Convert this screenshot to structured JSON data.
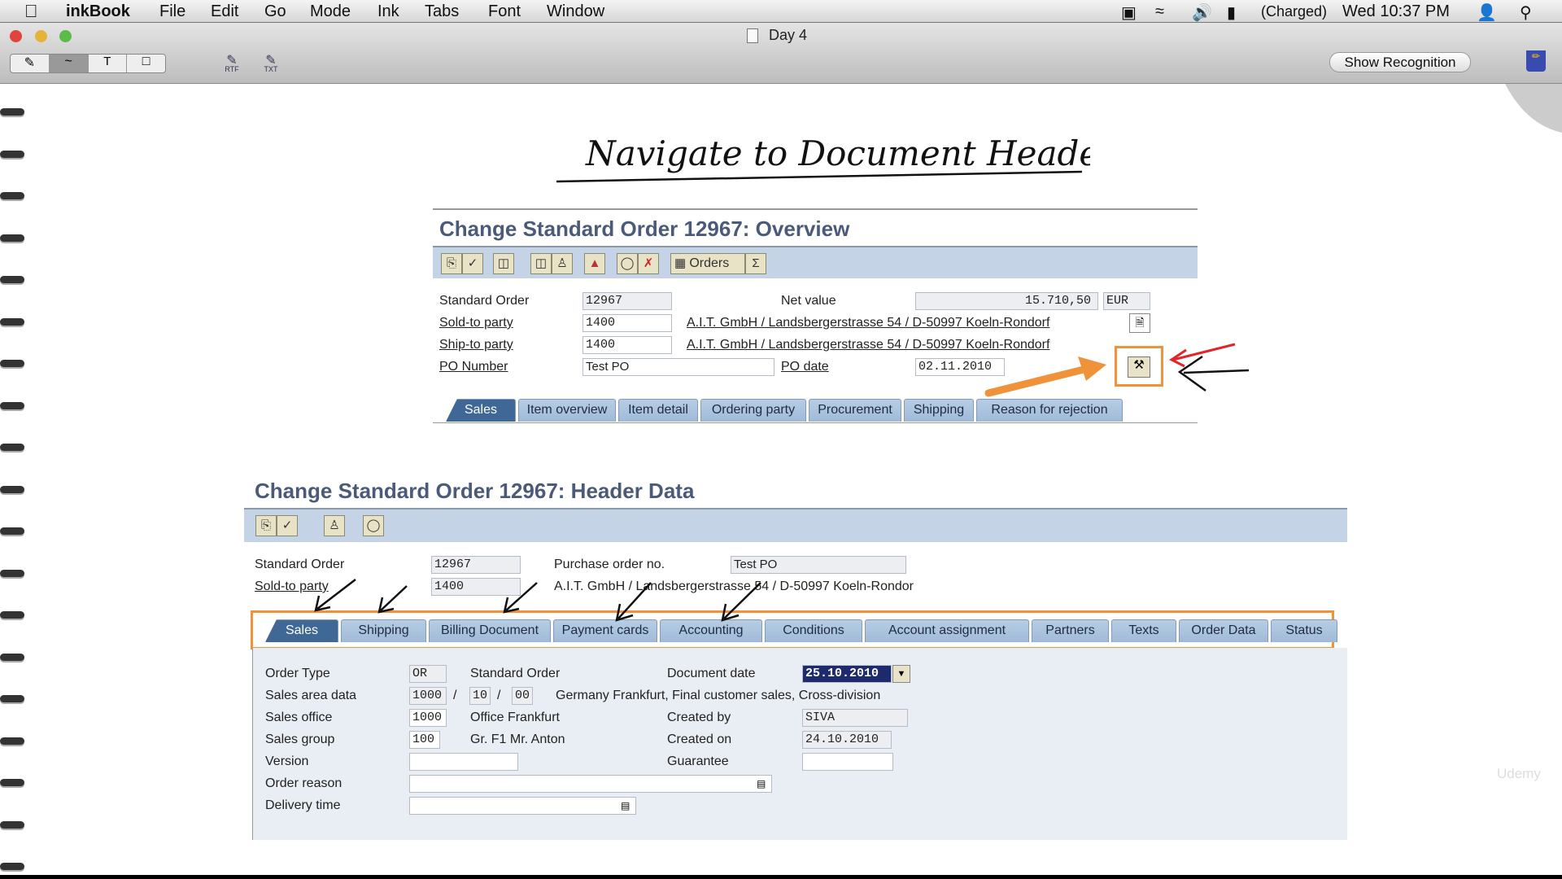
{
  "menubar": {
    "app": "inkBook",
    "items": [
      "File",
      "Edit",
      "Go",
      "Mode",
      "Ink",
      "Tabs",
      "Font",
      "Window"
    ],
    "battery": "(Charged)",
    "clock": "Wed 10:37 PM"
  },
  "window": {
    "title": "Day 4",
    "toolbar": {
      "rtf": "RTF",
      "txt": "TXT",
      "text_tool": "T"
    },
    "show_recognition": "Show Recognition"
  },
  "handwriting": "Navigate to Document Header",
  "overview": {
    "title": "Change Standard Order 12967: Overview",
    "orders_button": "Orders",
    "fields": {
      "standard_order_label": "Standard Order",
      "standard_order": "12967",
      "net_value_label": "Net value",
      "net_value": "15.710,50",
      "currency": "EUR",
      "sold_to_label": "Sold-to party",
      "sold_to": "1400",
      "sold_to_address": "A.I.T. GmbH / Landsbergerstrasse 54 / D-50997 Koeln-Rondorf",
      "ship_to_label": "Ship-to party",
      "ship_to": "1400",
      "ship_to_address": "A.I.T. GmbH / Landsbergerstrasse 54 / D-50997 Koeln-Rondorf",
      "po_number_label": "PO Number",
      "po_number": "Test PO",
      "po_date_label": "PO date",
      "po_date": "02.11.2010"
    },
    "tabs": [
      "Sales",
      "Item overview",
      "Item detail",
      "Ordering party",
      "Procurement",
      "Shipping",
      "Reason for rejection"
    ]
  },
  "header": {
    "title": "Change Standard Order 12967: Header Data",
    "fields": {
      "standard_order_label": "Standard Order",
      "standard_order": "12967",
      "po_label": "Purchase order no.",
      "po": "Test PO",
      "sold_to_label": "Sold-to party",
      "sold_to": "1400",
      "sold_to_address": "A.I.T. GmbH / Landsbergerstrasse 54 / D-50997 Koeln-Rondor"
    },
    "tabs": [
      "Sales",
      "Shipping",
      "Billing Document",
      "Payment cards",
      "Accounting",
      "Conditions",
      "Account assignment",
      "Partners",
      "Texts",
      "Order Data",
      "Status"
    ],
    "sales": {
      "order_type_label": "Order Type",
      "order_type": "OR",
      "order_type_desc": "Standard Order",
      "doc_date_label": "Document date",
      "doc_date": "25.10.2010",
      "sales_area_label": "Sales area data",
      "sales_org": "1000",
      "dist_channel": "10",
      "division": "00",
      "sales_area_desc": "Germany Frankfurt, Final customer sales, Cross-division",
      "sep": "/",
      "sales_office_label": "Sales office",
      "sales_office": "1000",
      "sales_office_desc": "Office Frankfurt",
      "created_by_label": "Created by",
      "created_by": "SIVA",
      "sales_group_label": "Sales group",
      "sales_group": "100",
      "sales_group_desc": "Gr. F1 Mr. Anton",
      "created_on_label": "Created on",
      "created_on": "24.10.2010",
      "version_label": "Version",
      "version": "",
      "guarantee_label": "Guarantee",
      "guarantee": "",
      "order_reason_label": "Order reason",
      "order_reason": "",
      "delivery_time_label": "Delivery time",
      "delivery_time": ""
    }
  },
  "watermark": "Udemy"
}
